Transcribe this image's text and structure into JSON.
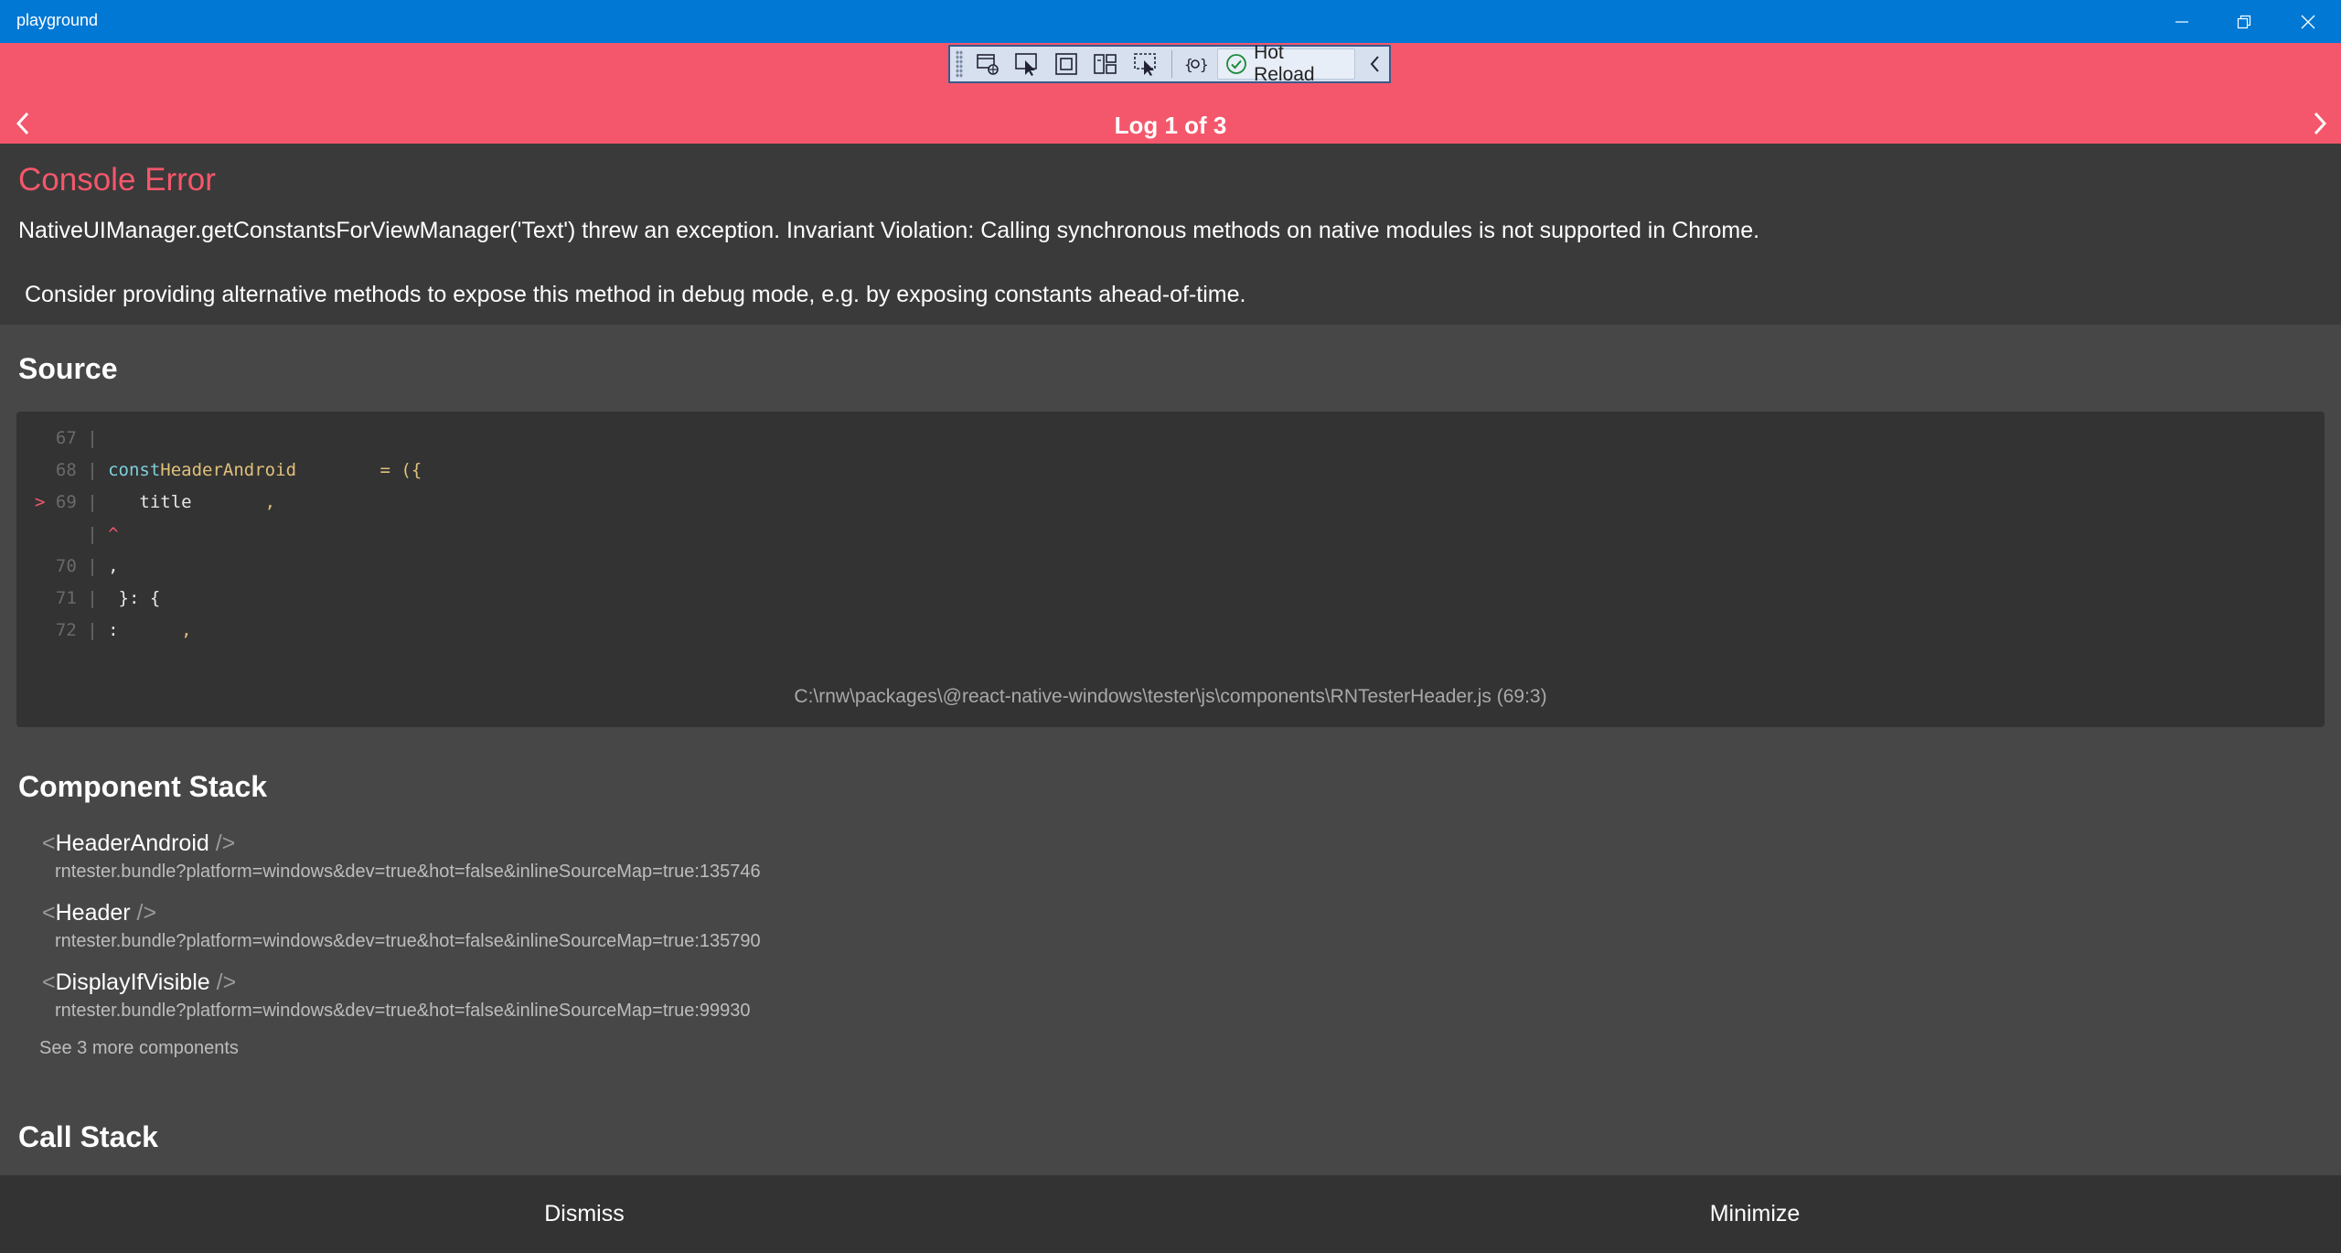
{
  "window": {
    "title": "playground"
  },
  "toolbar": {
    "hot_reload_label": "Hot Reload"
  },
  "header": {
    "log_counter": "Log 1 of 3"
  },
  "error": {
    "title": "Console Error",
    "message": "NativeUIManager.getConstantsForViewManager('Text') threw an exception. Invariant Violation: Calling synchronous methods on native modules is not supported in Chrome.\n\n Consider providing alternative methods to expose this method in debug mode, e.g. by exposing constants ahead-of-time."
  },
  "source": {
    "title": "Source",
    "lines": [
      {
        "marker": "",
        "num": "67",
        "tokens": []
      },
      {
        "marker": "",
        "num": "68",
        "tokens": [
          {
            "t": "const",
            "c": "kw"
          },
          {
            "t": "HeaderAndroid",
            "c": "ident"
          },
          {
            "t": "        = ({",
            "c": "punc"
          }
        ]
      },
      {
        "marker": ">",
        "num": "69",
        "tokens": [
          {
            "t": "   title",
            "c": "plain"
          },
          {
            "t": "       ,",
            "c": "punc"
          }
        ]
      },
      {
        "marker": "",
        "num": "",
        "tokens": [
          {
            "t": "^",
            "c": "caret"
          }
        ]
      },
      {
        "marker": "",
        "num": "70",
        "tokens": [
          {
            "t": ",",
            "c": "plain"
          }
        ]
      },
      {
        "marker": "",
        "num": "71",
        "tokens": [
          {
            "t": " }: {",
            "c": "plain"
          }
        ]
      },
      {
        "marker": "",
        "num": "72",
        "tokens": [
          {
            "t": ":",
            "c": "plain"
          },
          {
            "t": "      ,",
            "c": "punc"
          }
        ]
      }
    ],
    "path": "C:\\rnw\\packages\\@react-native-windows\\tester\\js\\components\\RNTesterHeader.js (69:3)"
  },
  "component_stack": {
    "title": "Component Stack",
    "items": [
      {
        "name": "HeaderAndroid",
        "location": "rntester.bundle?platform=windows&dev=true&hot=false&inlineSourceMap=true:135746"
      },
      {
        "name": "Header",
        "location": "rntester.bundle?platform=windows&dev=true&hot=false&inlineSourceMap=true:135790"
      },
      {
        "name": "DisplayIfVisible",
        "location": "rntester.bundle?platform=windows&dev=true&hot=false&inlineSourceMap=true:99930"
      }
    ],
    "see_more": "See 3 more components"
  },
  "call_stack": {
    "title": "Call Stack"
  },
  "footer": {
    "dismiss_label": "Dismiss",
    "minimize_label": "Minimize"
  }
}
